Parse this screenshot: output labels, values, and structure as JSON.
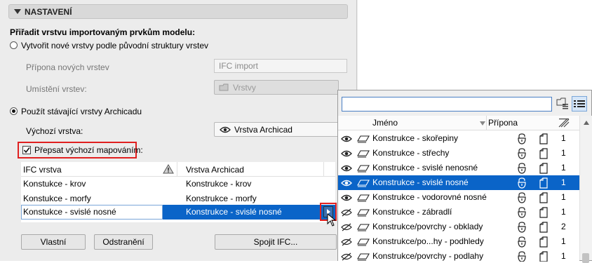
{
  "section": {
    "title": "NASTAVENÍ"
  },
  "assign_label": "Přiřadit vrstvu importovaným prvkům modelu:",
  "option_new": {
    "label": "Vytvořit nové vrstvy podle původní struktury vrstev",
    "suffix_label": "Přípona nových vrstev",
    "suffix_value": "IFC import",
    "location_label": "Umístění vrstev:",
    "location_value": "Vrstvy"
  },
  "option_existing": {
    "label": "Použít stávající vrstvy Archicadu",
    "default_label": "Výchozí vrstva:",
    "default_value": "Vrstva Archicad"
  },
  "override_checkbox": {
    "label": "Přepsat výchozí mapováním:",
    "checked": true
  },
  "mapping_table": {
    "col_ifc": "IFC vrstva",
    "col_archicad": "Vrstva Archicad",
    "rows": [
      {
        "ifc": "Konstukce - krov",
        "archicad": "Konstrukce - krov"
      },
      {
        "ifc": "Konstukce - morfy",
        "archicad": "Konstrukce - morfy"
      },
      {
        "ifc": "Konstukce - svislé nosné",
        "archicad": "Konstrukce - svislé nosné"
      }
    ]
  },
  "buttons": {
    "custom": "Vlastní",
    "remove": "Odstranění",
    "merge": "Spojit IFC..."
  },
  "popup": {
    "search_value": "",
    "col_name": "Jméno",
    "col_suffix": "Přípona",
    "layers": [
      {
        "name": "Konstrukce - skořepiny",
        "num": "1"
      },
      {
        "name": "Konstrukce - střechy",
        "num": "1"
      },
      {
        "name": "Konstrukce - svislé nenosné",
        "num": "1"
      },
      {
        "name": "Konstrukce - svislé nosné",
        "num": "1"
      },
      {
        "name": "Konstrukce - vodorovné nosné",
        "num": "1"
      },
      {
        "name": "Konstrukce - zábradlí",
        "num": "1"
      },
      {
        "name": "Konstrukce/povrchy - obklady",
        "num": "2"
      },
      {
        "name": "Konstrukce/po...hy - podhledy",
        "num": "1"
      },
      {
        "name": "Konstrukce/povrchy - podlahy",
        "num": "1"
      }
    ]
  },
  "colors": {
    "selection": "#0a64c8",
    "highlight_box": "#e02020"
  }
}
